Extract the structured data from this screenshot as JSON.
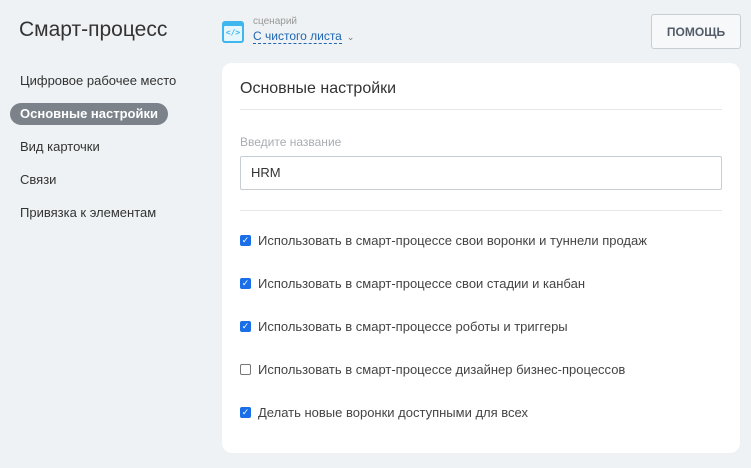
{
  "header": {
    "title": "Смарт-процесс",
    "scenario_label": "сценарий",
    "scenario_value": "С чистого листа",
    "help": "ПОМОЩЬ"
  },
  "nav": [
    "Цифровое рабочее место",
    "Основные настройки",
    "Вид карточки",
    "Связи",
    "Привязка к элементам"
  ],
  "card": {
    "title": "Основные настройки",
    "name_label": "Введите название",
    "name_value": "HRM",
    "options": [
      {
        "label": "Использовать в смарт-процессе свои воронки и туннели продаж",
        "checked": true
      },
      {
        "label": "Использовать в смарт-процессе свои стадии и канбан",
        "checked": true
      },
      {
        "label": "Использовать в смарт-процессе роботы и триггеры",
        "checked": true
      },
      {
        "label": "Использовать в смарт-процессе дизайнер бизнес-процессов",
        "checked": false
      },
      {
        "label": "Делать новые воронки доступными для всех",
        "checked": true
      }
    ]
  }
}
